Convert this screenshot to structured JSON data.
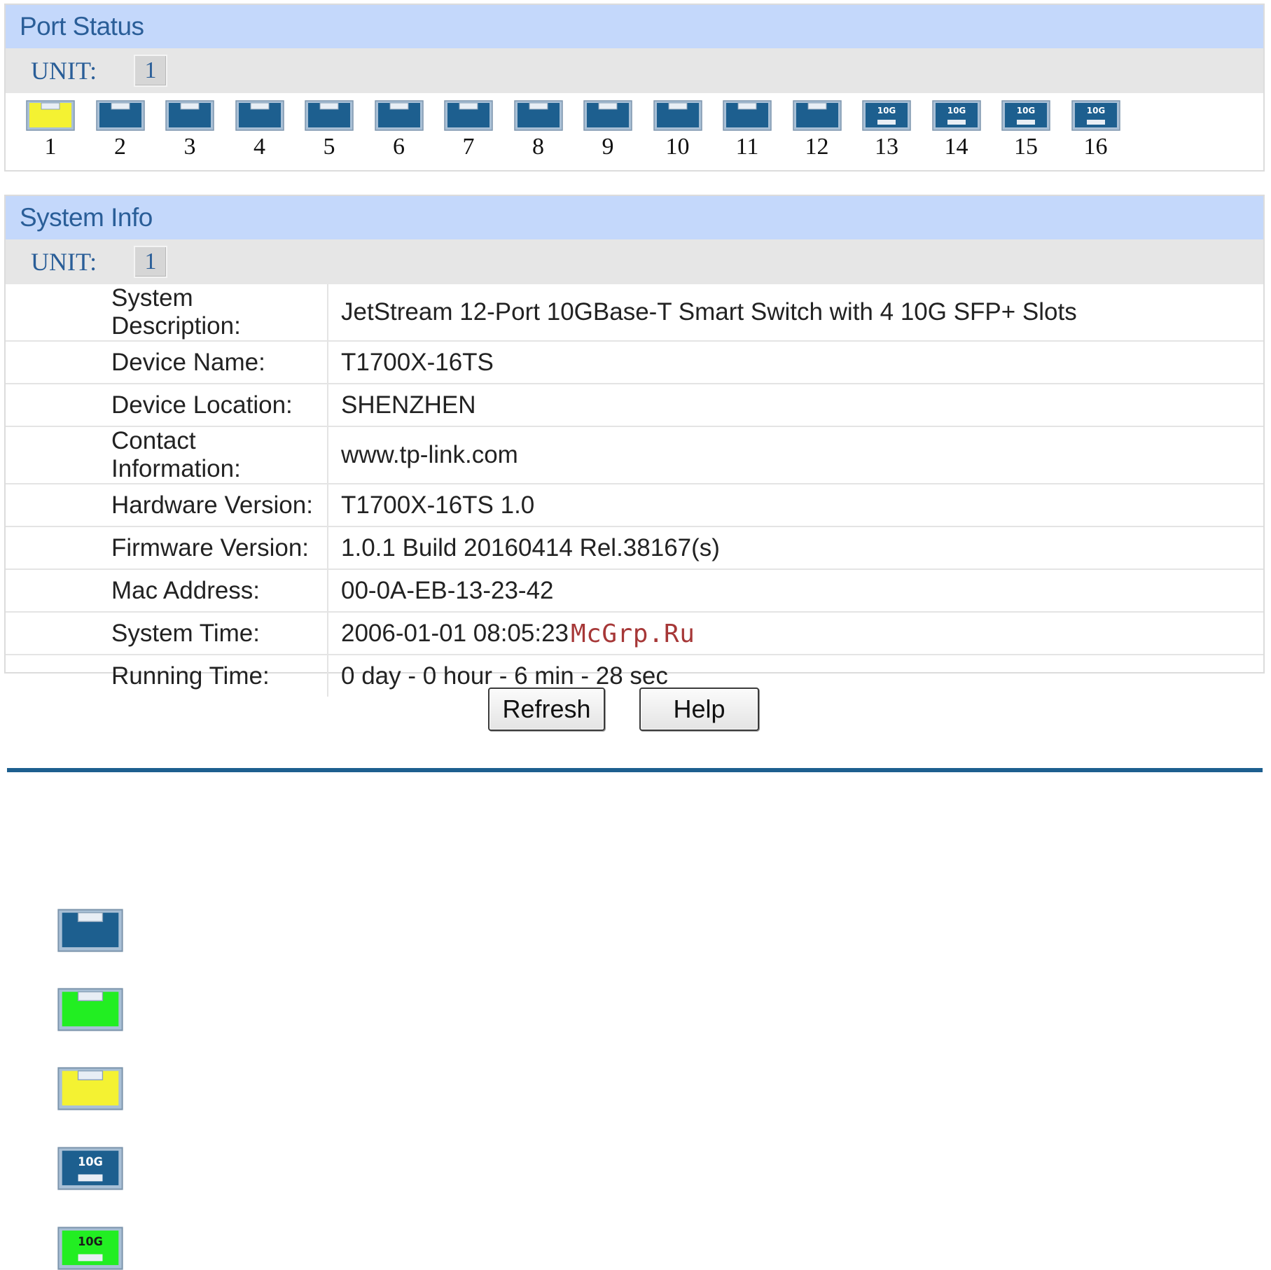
{
  "colors": {
    "header_bg": "#c4d8fb",
    "header_text": "#2a5e98",
    "port_idle": "#1d5f8f",
    "port_link_up": "#22ee22",
    "port_selected": "#f4f232",
    "divider": "#1d5f8f"
  },
  "port_status": {
    "title": "Port Status",
    "unit_label": "UNIT:",
    "unit_value": "1",
    "ports": [
      {
        "number": "1",
        "type": "copper",
        "state": "selected",
        "icon": "port-selected-icon"
      },
      {
        "number": "2",
        "type": "copper",
        "state": "idle",
        "icon": "port-icon"
      },
      {
        "number": "3",
        "type": "copper",
        "state": "idle",
        "icon": "port-icon"
      },
      {
        "number": "4",
        "type": "copper",
        "state": "idle",
        "icon": "port-icon"
      },
      {
        "number": "5",
        "type": "copper",
        "state": "idle",
        "icon": "port-icon"
      },
      {
        "number": "6",
        "type": "copper",
        "state": "idle",
        "icon": "port-icon"
      },
      {
        "number": "7",
        "type": "copper",
        "state": "idle",
        "icon": "port-icon"
      },
      {
        "number": "8",
        "type": "copper",
        "state": "idle",
        "icon": "port-icon"
      },
      {
        "number": "9",
        "type": "copper",
        "state": "idle",
        "icon": "port-icon"
      },
      {
        "number": "10",
        "type": "copper",
        "state": "idle",
        "icon": "port-icon"
      },
      {
        "number": "11",
        "type": "copper",
        "state": "idle",
        "icon": "port-icon"
      },
      {
        "number": "12",
        "type": "copper",
        "state": "idle",
        "icon": "port-icon"
      },
      {
        "number": "13",
        "type": "sfp",
        "state": "idle",
        "label": "10G",
        "icon": "sfp-port-icon"
      },
      {
        "number": "14",
        "type": "sfp",
        "state": "idle",
        "label": "10G",
        "icon": "sfp-port-icon"
      },
      {
        "number": "15",
        "type": "sfp",
        "state": "idle",
        "label": "10G",
        "icon": "sfp-port-icon"
      },
      {
        "number": "16",
        "type": "sfp",
        "state": "idle",
        "label": "10G",
        "icon": "sfp-port-icon"
      }
    ]
  },
  "system_info": {
    "title": "System Info",
    "unit_label": "UNIT:",
    "unit_value": "1",
    "rows": [
      {
        "label": "System Description:",
        "value": "JetStream 12-Port 10GBase-T Smart Switch with 4 10G SFP+ Slots"
      },
      {
        "label": "Device Name:",
        "value": "T1700X-16TS"
      },
      {
        "label": "Device Location:",
        "value": "SHENZHEN"
      },
      {
        "label": "Contact Information:",
        "value": "www.tp-link.com"
      },
      {
        "label": "Hardware Version:",
        "value": "T1700X-16TS 1.0"
      },
      {
        "label": "Firmware Version:",
        "value": "1.0.1 Build 20160414 Rel.38167(s)"
      },
      {
        "label": "Mac Address:",
        "value": "00-0A-EB-13-23-42"
      },
      {
        "label": "System Time:",
        "value": "2006-01-01 08:05:23"
      },
      {
        "label": "Running Time:",
        "value": "0 day - 0 hour - 6 min - 28 sec"
      }
    ]
  },
  "buttons": {
    "refresh": "Refresh",
    "help": "Help"
  },
  "watermark": "McGrp.Ru",
  "legend": [
    {
      "type": "copper",
      "state": "idle",
      "icon": "port-down-icon"
    },
    {
      "type": "copper",
      "state": "link_up",
      "icon": "port-link-up-icon"
    },
    {
      "type": "copper",
      "state": "selected",
      "icon": "port-selected-icon"
    },
    {
      "type": "sfp",
      "state": "idle",
      "label": "10G",
      "icon": "sfp-port-down-icon"
    },
    {
      "type": "sfp",
      "state": "link_up",
      "label": "10G",
      "icon": "sfp-port-link-up-icon"
    }
  ]
}
